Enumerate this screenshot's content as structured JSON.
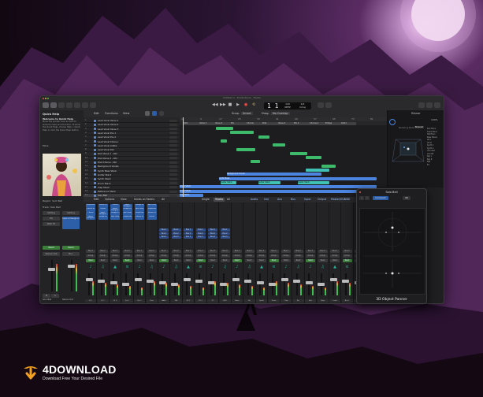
{
  "colors": {
    "sky_glow": "#c99ad0",
    "window_bg": "#1f1f21",
    "region_green": "#3dbb6a",
    "region_teal": "#3fc2b4",
    "region_blue": "#4b85e0",
    "region_pink": "#e06fb0",
    "accent_blue": "#2d5fa8",
    "brand_orange": "#f2a01e"
  },
  "window": {
    "title": "Untitled 1 - Productions - Tracks"
  },
  "toolbar": {
    "position": "1  1",
    "tempo": "120",
    "tempo_label": "KEEP",
    "signature": "4/4",
    "key": "Cmaj"
  },
  "quick_help": {
    "title": "Quick Help",
    "heading": "Welcome to Quick Help",
    "body": "Move the pointer over an item to show its name and function. To show the Quick Help, choose Help > Quick Help or click the Quick Help button.",
    "more": "More"
  },
  "inspector": {
    "region_label": "Region: Solo Bell",
    "track_label": "Track: Solo Bell",
    "setting": "Setting",
    "eq": "EQ",
    "midi_fx": "MIDI FX",
    "read": "Read",
    "stereo_out": "Stereo Out",
    "bnc": "Bnc",
    "m_label": "M",
    "s_label": "S",
    "strip_a": "Solo Bell",
    "strip_b": "Stereo Out"
  },
  "arrange": {
    "menu": [
      "Edit",
      "Functions",
      "View"
    ],
    "snap_label": "Snap:",
    "snap_value": "Smart",
    "drag_label": "Drag:",
    "drag_value": "No Overlap"
  },
  "tracks": [
    {
      "num": "1",
      "name": "Lead Vocal Verse 1"
    },
    {
      "num": "2",
      "name": "Lead Vocal Verse 2"
    },
    {
      "num": "3",
      "name": "Lead Vocal Verse 3"
    },
    {
      "num": "4",
      "name": "Lead Vocal Pre 1"
    },
    {
      "num": "5",
      "name": "Lead Vocal Pre 2"
    },
    {
      "num": "6",
      "name": "Lead Vocal Chorus"
    },
    {
      "num": "7",
      "name": "Lead Vocal Adlibs"
    },
    {
      "num": "8",
      "name": "Lead Vocal Dbl"
    },
    {
      "num": "9",
      "name": "Post Verse 1 - Dbl"
    },
    {
      "num": "10",
      "name": "Post Verse 2 - Dbl"
    },
    {
      "num": "11",
      "name": "Post Chorus - Dbl"
    },
    {
      "num": "12",
      "name": "Background Vocals"
    },
    {
      "num": "13",
      "name": "Synth Bass Stack"
    },
    {
      "num": "14",
      "name": "Guitar Stack"
    },
    {
      "num": "15",
      "name": "Synth Stack"
    },
    {
      "num": "16",
      "name": "Drum Stack"
    },
    {
      "num": "17",
      "name": "Clap Stack"
    },
    {
      "num": "18",
      "name": "Reference Stack"
    },
    {
      "num": "19",
      "name": "Solo Bell"
    },
    {
      "num": "20",
      "name": "Guitar Synth"
    },
    {
      "num": "21",
      "name": "Synth Lead"
    }
  ],
  "ruler": [
    "1",
    "9",
    "17",
    "25",
    "33",
    "41",
    "49",
    "57",
    "65",
    "73",
    "81"
  ],
  "markers": [
    "Intro",
    "Verse 1",
    "Verse 2",
    "Pre",
    "Chorus",
    "Post",
    "Verse 2",
    "Pre 2",
    "Chorus 2",
    "Bridge",
    "Outro"
  ],
  "regions_labels": {
    "synth_bass": "Synth Bass",
    "guitar": "Guitar Stack",
    "drums": "Drum Stack",
    "clap": "Clap Stem",
    "reference": "Reference Stack",
    "background": "Background Vocals"
  },
  "binner": {
    "title": "Binner",
    "zoom": "100%",
    "room_label": "Rendering Mode",
    "room_value": "Binaural",
    "list": [
      "Kick Mono",
      "Snare Mono",
      "Hat Mono",
      "Bass Stereo",
      "Gtr L",
      "Gtr R",
      "Synth 1",
      "Synth 2",
      "Vox Lead",
      "Vox Dbl",
      "Bgv L",
      "Bgv R",
      "Bell",
      "FX"
    ]
  },
  "mixer": {
    "tabs": [
      "Edit",
      "Options",
      "View",
      "Sends on Faders",
      "All"
    ],
    "views": [
      "Single",
      "Tracks",
      "All"
    ],
    "filters": [
      "Audio",
      "Inst",
      "Aux",
      "Bus",
      "Input",
      "Output",
      "Master/VCA",
      "MIDI"
    ],
    "plugins": [
      "Compressor",
      "Channel EQ",
      "Chorus",
      "Space Designer",
      "Vintage EQ",
      "Tape Delay"
    ],
    "send_labels": [
      "Bus 1",
      "Bus 2",
      "Bus 3",
      "Bus 4"
    ],
    "group": "Group",
    "automation": "Read",
    "strips": [
      "LV 1",
      "LV 2",
      "LV 3",
      "Pre 1",
      "Pre 2",
      "Chor",
      "Adlib",
      "Dbl",
      "PV 1",
      "PV 2",
      "PC",
      "BGV",
      "Bass",
      "Gtr",
      "Synth",
      "Drum",
      "Clap",
      "Ref",
      "Bell",
      "GSyn",
      "Lead",
      "Bus 1",
      "Bus 2",
      "Out"
    ]
  },
  "panner": {
    "title": "Solo Bell",
    "mode": "Compact",
    "value": "96",
    "footer": "3D Object Panner"
  },
  "brand": {
    "name": "4DOWNLOAD",
    "tagline": "Download Free Your Desired File"
  }
}
